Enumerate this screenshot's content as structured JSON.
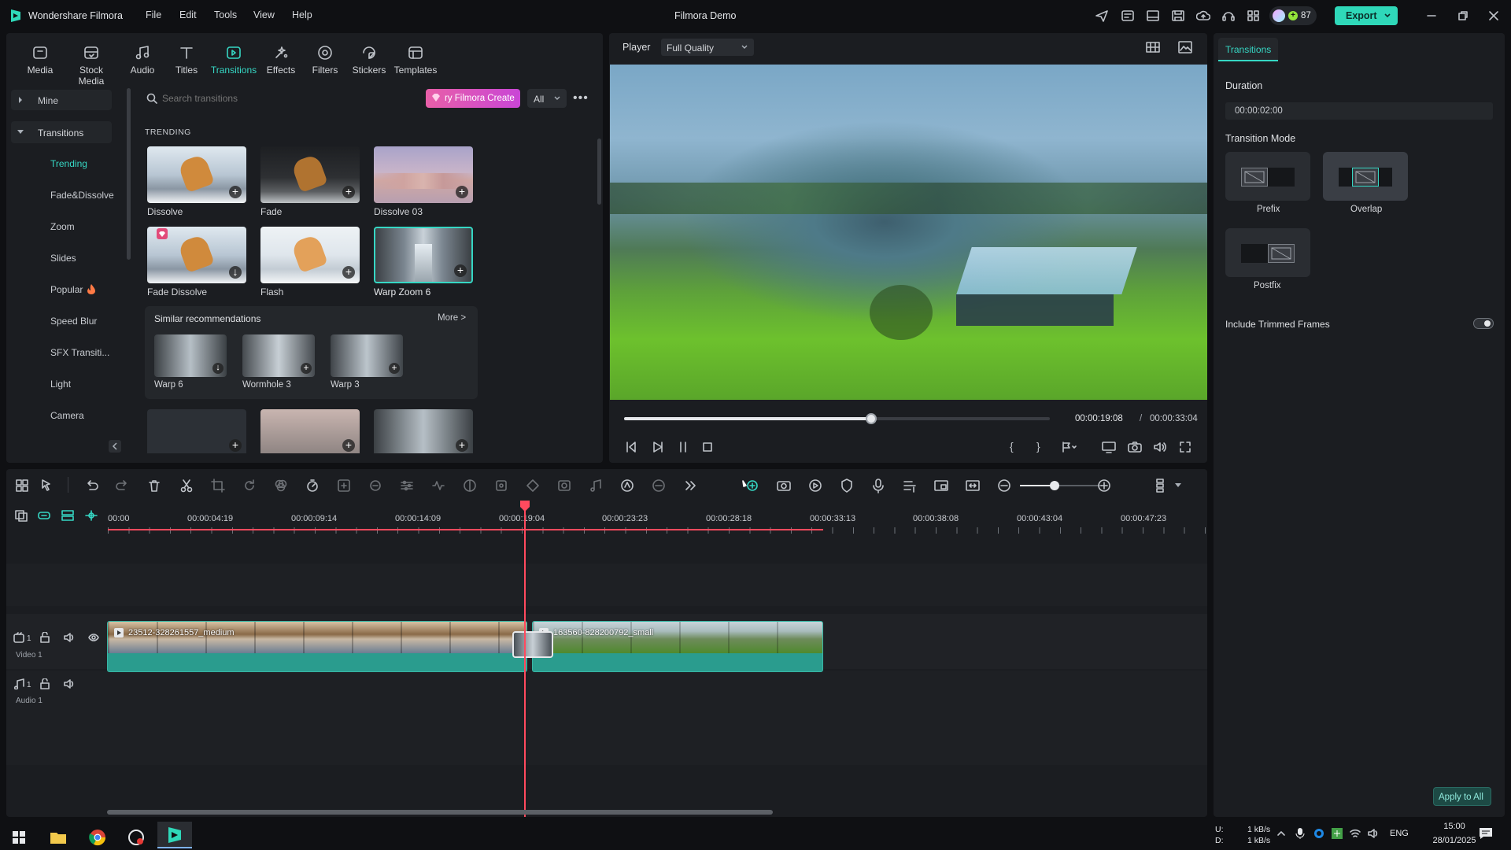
{
  "app": {
    "name": "Wondershare Filmora",
    "project_title": "Filmora Demo",
    "menu": [
      "File",
      "Edit",
      "Tools",
      "View",
      "Help"
    ],
    "credits": "87",
    "export_label": "Export"
  },
  "toolbar": {
    "tabs": [
      {
        "label": "Media",
        "icon": "media-icon"
      },
      {
        "label": "Stock Media",
        "icon": "stock-media-icon"
      },
      {
        "label": "Audio",
        "icon": "audio-icon"
      },
      {
        "label": "Titles",
        "icon": "titles-icon"
      },
      {
        "label": "Transitions",
        "icon": "transitions-icon",
        "active": true
      },
      {
        "label": "Effects",
        "icon": "effects-icon"
      },
      {
        "label": "Filters",
        "icon": "filters-icon"
      },
      {
        "label": "Stickers",
        "icon": "stickers-icon"
      },
      {
        "label": "Templates",
        "icon": "templates-icon"
      }
    ]
  },
  "sidebar": {
    "mine": "Mine",
    "transitions": "Transitions",
    "items": [
      "Trending",
      "Fade&Dissolve",
      "Zoom",
      "Slides",
      "Popular",
      "Speed Blur",
      "SFX Transiti...",
      "Light",
      "Camera"
    ]
  },
  "library": {
    "search_placeholder": "Search transitions",
    "promo": "ry Filmora Create",
    "filter": "All",
    "section": "TRENDING",
    "items": [
      "Dissolve",
      "Fade",
      "Dissolve 03",
      "Fade Dissolve",
      "Flash",
      "Warp Zoom 6"
    ],
    "similar_title": "Similar recommendations",
    "more": "More >",
    "similar": [
      "Warp 6",
      "Wormhole 3",
      "Warp 3"
    ]
  },
  "player": {
    "label": "Player",
    "quality": "Full Quality",
    "current_time": "00:00:19:08",
    "separator": "/",
    "total_time": "00:00:33:04",
    "progress": 0.58
  },
  "properties": {
    "tab": "Transitions",
    "duration_label": "Duration",
    "duration_value": "00:00:02:00",
    "mode_label": "Transition Mode",
    "modes": [
      "Prefix",
      "Overlap",
      "Postfix"
    ],
    "selected_mode": "Overlap",
    "trim_label": "Include Trimmed Frames",
    "apply_all": "Apply to All"
  },
  "timeline": {
    "ruler": [
      "00:00",
      "00:00:04:19",
      "00:00:09:14",
      "00:00:14:09",
      "00:00:19:04",
      "00:00:23:23",
      "00:00:28:18",
      "00:00:33:13",
      "00:00:38:08",
      "00:00:43:04",
      "00:00:47:23"
    ],
    "video_track_label": "Video 1",
    "audio_track_label": "Audio 1",
    "track_num_video": "1",
    "track_num_audio": "1",
    "clip1": "23512-328261557_medium",
    "clip2": "163560-828200792_small"
  },
  "taskbar": {
    "net_up": "1 kB/s",
    "net_down": "1 kB/s",
    "net_u": "U:",
    "net_d": "D:",
    "lang": "ENG",
    "time": "15:00",
    "date": "28/01/2025"
  },
  "colors": {
    "accent": "#36d7c4",
    "playhead": "#ff4a5e",
    "export_bg": "#2fd8b9"
  }
}
